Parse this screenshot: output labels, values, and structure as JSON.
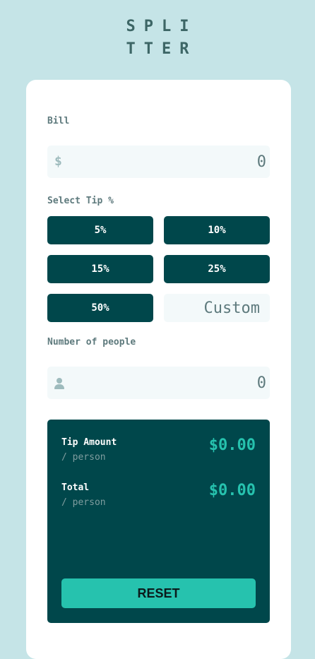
{
  "logo": {
    "line1": "SPLI",
    "line2": "TTER"
  },
  "bill": {
    "label": "Bill",
    "currency_glyph": "$",
    "value": "0",
    "icon": "dollar-icon"
  },
  "tip": {
    "label": "Select Tip %",
    "options": [
      "5%",
      "10%",
      "15%",
      "25%",
      "50%"
    ],
    "custom_placeholder": "Custom"
  },
  "people": {
    "label": "Number of people",
    "value": "0",
    "icon": "person-icon"
  },
  "results": {
    "tip_amount": {
      "label": "Tip Amount",
      "sub": "/ person",
      "value": "$0.00"
    },
    "total": {
      "label": "Total",
      "sub": "/ person",
      "value": "$0.00"
    },
    "reset_label": "RESET"
  },
  "colors": {
    "background": "#c5e4e7",
    "dark_cyan": "#00474b",
    "strong_cyan": "#26c2ae",
    "input_bg": "#f3f9fa",
    "label_gray": "#5e7a7d"
  }
}
